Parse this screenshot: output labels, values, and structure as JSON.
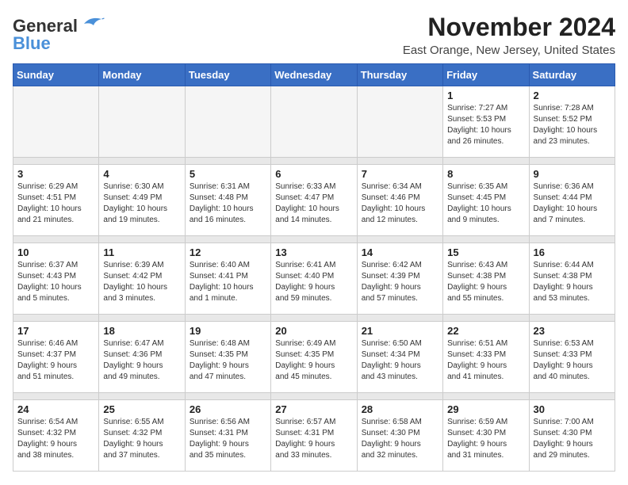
{
  "header": {
    "logo_line1": "General",
    "logo_line2": "Blue",
    "month_title": "November 2024",
    "location": "East Orange, New Jersey, United States"
  },
  "weekdays": [
    "Sunday",
    "Monday",
    "Tuesday",
    "Wednesday",
    "Thursday",
    "Friday",
    "Saturday"
  ],
  "weeks": [
    [
      {
        "day": "",
        "info": ""
      },
      {
        "day": "",
        "info": ""
      },
      {
        "day": "",
        "info": ""
      },
      {
        "day": "",
        "info": ""
      },
      {
        "day": "",
        "info": ""
      },
      {
        "day": "1",
        "info": "Sunrise: 7:27 AM\nSunset: 5:53 PM\nDaylight: 10 hours\nand 26 minutes."
      },
      {
        "day": "2",
        "info": "Sunrise: 7:28 AM\nSunset: 5:52 PM\nDaylight: 10 hours\nand 23 minutes."
      }
    ],
    [
      {
        "day": "3",
        "info": "Sunrise: 6:29 AM\nSunset: 4:51 PM\nDaylight: 10 hours\nand 21 minutes."
      },
      {
        "day": "4",
        "info": "Sunrise: 6:30 AM\nSunset: 4:49 PM\nDaylight: 10 hours\nand 19 minutes."
      },
      {
        "day": "5",
        "info": "Sunrise: 6:31 AM\nSunset: 4:48 PM\nDaylight: 10 hours\nand 16 minutes."
      },
      {
        "day": "6",
        "info": "Sunrise: 6:33 AM\nSunset: 4:47 PM\nDaylight: 10 hours\nand 14 minutes."
      },
      {
        "day": "7",
        "info": "Sunrise: 6:34 AM\nSunset: 4:46 PM\nDaylight: 10 hours\nand 12 minutes."
      },
      {
        "day": "8",
        "info": "Sunrise: 6:35 AM\nSunset: 4:45 PM\nDaylight: 10 hours\nand 9 minutes."
      },
      {
        "day": "9",
        "info": "Sunrise: 6:36 AM\nSunset: 4:44 PM\nDaylight: 10 hours\nand 7 minutes."
      }
    ],
    [
      {
        "day": "10",
        "info": "Sunrise: 6:37 AM\nSunset: 4:43 PM\nDaylight: 10 hours\nand 5 minutes."
      },
      {
        "day": "11",
        "info": "Sunrise: 6:39 AM\nSunset: 4:42 PM\nDaylight: 10 hours\nand 3 minutes."
      },
      {
        "day": "12",
        "info": "Sunrise: 6:40 AM\nSunset: 4:41 PM\nDaylight: 10 hours\nand 1 minute."
      },
      {
        "day": "13",
        "info": "Sunrise: 6:41 AM\nSunset: 4:40 PM\nDaylight: 9 hours\nand 59 minutes."
      },
      {
        "day": "14",
        "info": "Sunrise: 6:42 AM\nSunset: 4:39 PM\nDaylight: 9 hours\nand 57 minutes."
      },
      {
        "day": "15",
        "info": "Sunrise: 6:43 AM\nSunset: 4:38 PM\nDaylight: 9 hours\nand 55 minutes."
      },
      {
        "day": "16",
        "info": "Sunrise: 6:44 AM\nSunset: 4:38 PM\nDaylight: 9 hours\nand 53 minutes."
      }
    ],
    [
      {
        "day": "17",
        "info": "Sunrise: 6:46 AM\nSunset: 4:37 PM\nDaylight: 9 hours\nand 51 minutes."
      },
      {
        "day": "18",
        "info": "Sunrise: 6:47 AM\nSunset: 4:36 PM\nDaylight: 9 hours\nand 49 minutes."
      },
      {
        "day": "19",
        "info": "Sunrise: 6:48 AM\nSunset: 4:35 PM\nDaylight: 9 hours\nand 47 minutes."
      },
      {
        "day": "20",
        "info": "Sunrise: 6:49 AM\nSunset: 4:35 PM\nDaylight: 9 hours\nand 45 minutes."
      },
      {
        "day": "21",
        "info": "Sunrise: 6:50 AM\nSunset: 4:34 PM\nDaylight: 9 hours\nand 43 minutes."
      },
      {
        "day": "22",
        "info": "Sunrise: 6:51 AM\nSunset: 4:33 PM\nDaylight: 9 hours\nand 41 minutes."
      },
      {
        "day": "23",
        "info": "Sunrise: 6:53 AM\nSunset: 4:33 PM\nDaylight: 9 hours\nand 40 minutes."
      }
    ],
    [
      {
        "day": "24",
        "info": "Sunrise: 6:54 AM\nSunset: 4:32 PM\nDaylight: 9 hours\nand 38 minutes."
      },
      {
        "day": "25",
        "info": "Sunrise: 6:55 AM\nSunset: 4:32 PM\nDaylight: 9 hours\nand 37 minutes."
      },
      {
        "day": "26",
        "info": "Sunrise: 6:56 AM\nSunset: 4:31 PM\nDaylight: 9 hours\nand 35 minutes."
      },
      {
        "day": "27",
        "info": "Sunrise: 6:57 AM\nSunset: 4:31 PM\nDaylight: 9 hours\nand 33 minutes."
      },
      {
        "day": "28",
        "info": "Sunrise: 6:58 AM\nSunset: 4:30 PM\nDaylight: 9 hours\nand 32 minutes."
      },
      {
        "day": "29",
        "info": "Sunrise: 6:59 AM\nSunset: 4:30 PM\nDaylight: 9 hours\nand 31 minutes."
      },
      {
        "day": "30",
        "info": "Sunrise: 7:00 AM\nSunset: 4:30 PM\nDaylight: 9 hours\nand 29 minutes."
      }
    ]
  ]
}
